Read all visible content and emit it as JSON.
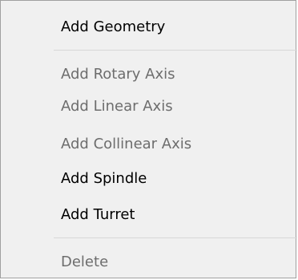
{
  "menu": {
    "items": [
      {
        "label": "Add Geometry",
        "enabled": true
      },
      {
        "label": "Add Rotary Axis",
        "enabled": false
      },
      {
        "label": "Add Linear Axis",
        "enabled": false
      },
      {
        "label": "Add Collinear Axis",
        "enabled": false
      },
      {
        "label": "Add Spindle",
        "enabled": true
      },
      {
        "label": "Add Turret",
        "enabled": true
      },
      {
        "label": "Delete",
        "enabled": false
      }
    ],
    "colors": {
      "background": "#f0f0f0",
      "enabled_text": "#000000",
      "disabled_text": "#6d6d6d",
      "separator": "#d7d7d7",
      "border": "#a0a0a0"
    }
  }
}
